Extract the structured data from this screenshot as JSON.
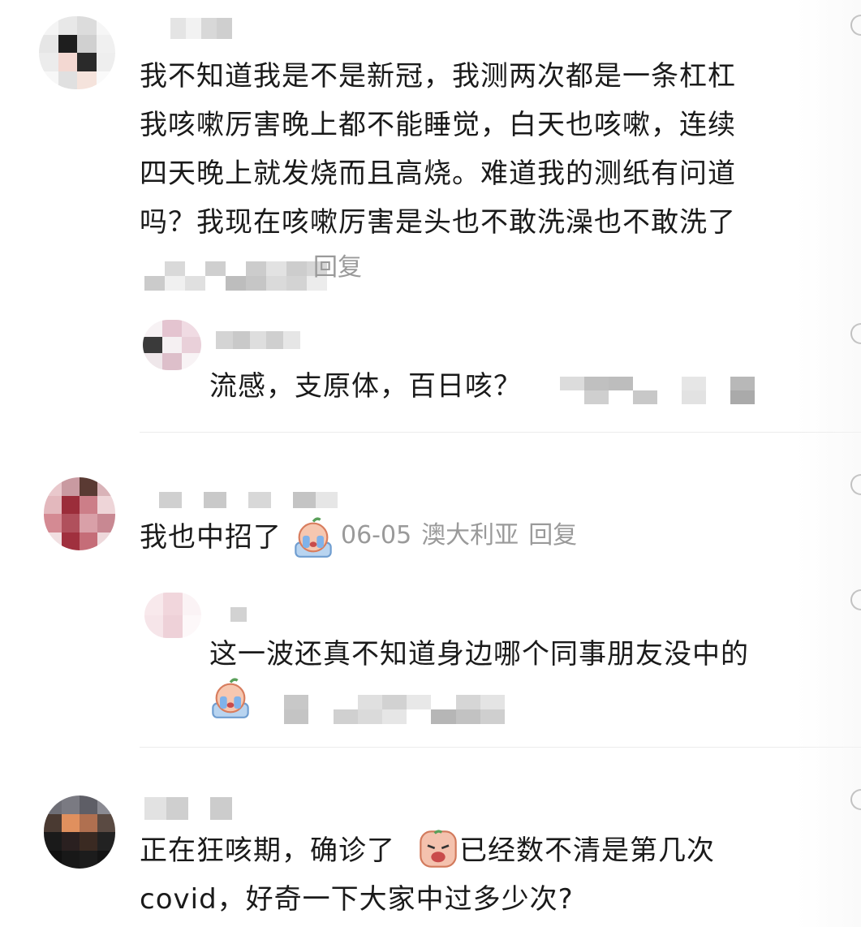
{
  "comments": [
    {
      "text_lines": [
        "我不知道我是不是新冠，我测两次都是一条杠杠",
        "我咳嗽厉害晚上都不能睡觉，白天也咳嗽，连续",
        "四天晚上就发烧而且高烧。难道我的测纸有问道",
        "吗？我现在咳嗽厉害是头也不敢洗澡也不敢洗了"
      ],
      "reply_label": "回复",
      "replies": [
        {
          "text": "流感，支原体，百日咳？"
        }
      ]
    },
    {
      "text": "我也中招了",
      "date": "06-05",
      "location": "澳大利亚",
      "reply_label": "回复",
      "replies": [
        {
          "text": "这一波还真不知道身边哪个同事朋友没中的"
        }
      ]
    },
    {
      "text_line1_a": "正在狂咳期，确诊了",
      "text_line1_b": "已经数不清是第几次",
      "text_line2": "covid，好奇一下大家中过多少次?"
    }
  ],
  "icons": {
    "like": "heart-outline-icon",
    "emoji_cry": "crying-emoji-icon",
    "emoji_sad": "sad-face-emoji-icon"
  },
  "colors": {
    "text": "#1a1a1a",
    "meta": "#9a9a9a",
    "divider": "#ececec"
  }
}
